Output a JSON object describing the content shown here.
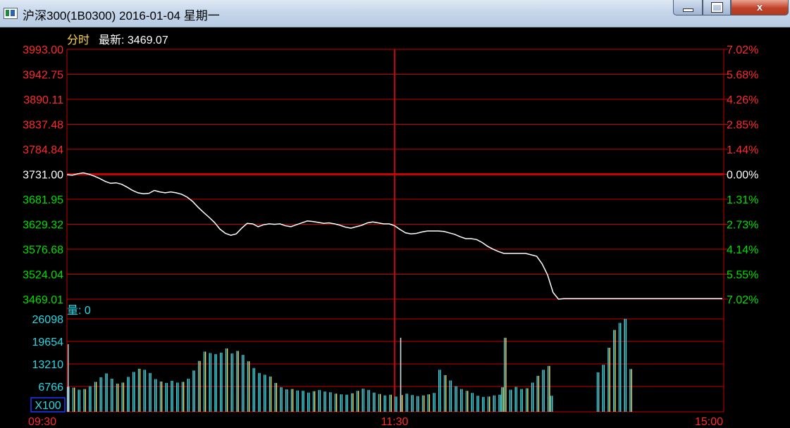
{
  "window": {
    "title": "沪深300(1B0300) 2016-01-04 星期一",
    "minimize_label": "",
    "maximize_label": "",
    "close_label": "x"
  },
  "header": {
    "mode_label": "分时",
    "latest_label": "最新: 3469.07",
    "volume_label": "量: 0"
  },
  "price_axis": {
    "left_ticks": [
      "3993.00",
      "3942.75",
      "3890.11",
      "3837.48",
      "3784.84",
      "3731.00",
      "3681.95",
      "3629.32",
      "3576.68",
      "3524.04",
      "3469.01"
    ],
    "right_ticks": [
      "7.02%",
      "5.68%",
      "4.26%",
      "2.85%",
      "1.44%",
      "0.00%",
      "1.31%",
      "2.73%",
      "4.14%",
      "5.55%",
      "7.02%"
    ],
    "up_color": "#ff2a2a",
    "flat_color": "#ffffff",
    "down_color": "#00e000"
  },
  "volume_axis": {
    "ticks": [
      "26098",
      "19654",
      "13210",
      "6766"
    ],
    "unit_label": "X100"
  },
  "time_axis": {
    "labels": [
      "09:30",
      "11:30",
      "15:00"
    ]
  },
  "chart_data": {
    "type": "line",
    "x_unit": "minutes since 09:30 session open",
    "reference_price": 3731.0,
    "ylim": [
      3469.01,
      3993.0
    ],
    "price": [
      [
        0,
        3730
      ],
      [
        2,
        3729
      ],
      [
        4,
        3732
      ],
      [
        6,
        3734
      ],
      [
        8,
        3731
      ],
      [
        10,
        3727
      ],
      [
        12,
        3722
      ],
      [
        14,
        3716
      ],
      [
        16,
        3712
      ],
      [
        18,
        3713
      ],
      [
        20,
        3710
      ],
      [
        22,
        3704
      ],
      [
        24,
        3697
      ],
      [
        26,
        3692
      ],
      [
        28,
        3690
      ],
      [
        30,
        3691
      ],
      [
        32,
        3697
      ],
      [
        34,
        3694
      ],
      [
        36,
        3692
      ],
      [
        38,
        3694
      ],
      [
        40,
        3692
      ],
      [
        42,
        3689
      ],
      [
        44,
        3683
      ],
      [
        46,
        3674
      ],
      [
        48,
        3662
      ],
      [
        50,
        3651
      ],
      [
        52,
        3641
      ],
      [
        54,
        3630
      ],
      [
        56,
        3616
      ],
      [
        58,
        3607
      ],
      [
        60,
        3603
      ],
      [
        62,
        3606
      ],
      [
        64,
        3618
      ],
      [
        66,
        3628
      ],
      [
        68,
        3627
      ],
      [
        70,
        3621
      ],
      [
        72,
        3625
      ],
      [
        74,
        3627
      ],
      [
        76,
        3626
      ],
      [
        78,
        3627
      ],
      [
        80,
        3623
      ],
      [
        82,
        3621
      ],
      [
        84,
        3625
      ],
      [
        86,
        3629
      ],
      [
        88,
        3633
      ],
      [
        90,
        3632
      ],
      [
        92,
        3630
      ],
      [
        94,
        3628
      ],
      [
        96,
        3629
      ],
      [
        98,
        3627
      ],
      [
        100,
        3624
      ],
      [
        102,
        3620
      ],
      [
        104,
        3618
      ],
      [
        106,
        3621
      ],
      [
        108,
        3624
      ],
      [
        110,
        3629
      ],
      [
        112,
        3631
      ],
      [
        114,
        3629
      ],
      [
        116,
        3627
      ],
      [
        118,
        3627
      ],
      [
        120,
        3623
      ],
      [
        122,
        3615
      ],
      [
        124,
        3608
      ],
      [
        126,
        3606
      ],
      [
        128,
        3607
      ],
      [
        130,
        3610
      ],
      [
        132,
        3612
      ],
      [
        134,
        3612
      ],
      [
        136,
        3612
      ],
      [
        138,
        3611
      ],
      [
        140,
        3608
      ],
      [
        142,
        3605
      ],
      [
        144,
        3600
      ],
      [
        146,
        3596
      ],
      [
        148,
        3596
      ],
      [
        150,
        3594
      ],
      [
        152,
        3588
      ],
      [
        154,
        3580
      ],
      [
        156,
        3574
      ],
      [
        158,
        3569
      ],
      [
        160,
        3565
      ],
      [
        162,
        3565
      ],
      [
        164,
        3565
      ],
      [
        166,
        3565
      ],
      [
        168,
        3565
      ],
      [
        170,
        3562
      ],
      [
        172,
        3559
      ],
      [
        174,
        3543
      ],
      [
        176,
        3520
      ],
      [
        178,
        3483
      ],
      [
        180,
        3469
      ],
      [
        182,
        3470
      ],
      [
        184,
        3470
      ],
      [
        186,
        3470
      ],
      [
        188,
        3470
      ],
      [
        190,
        3470
      ],
      [
        200,
        3470
      ],
      [
        210,
        3470
      ],
      [
        220,
        3470
      ],
      [
        230,
        3470
      ],
      [
        240,
        3470
      ]
    ],
    "volume_ylim": [
      0,
      26098
    ],
    "volume": [
      [
        0,
        7000
      ],
      [
        2,
        6800
      ],
      [
        4,
        6200
      ],
      [
        6,
        6400
      ],
      [
        8,
        7200
      ],
      [
        10,
        8400
      ],
      [
        12,
        9700
      ],
      [
        14,
        10800
      ],
      [
        16,
        9300
      ],
      [
        18,
        7900
      ],
      [
        20,
        8200
      ],
      [
        22,
        9800
      ],
      [
        24,
        11200
      ],
      [
        26,
        12100
      ],
      [
        28,
        11800
      ],
      [
        30,
        10900
      ],
      [
        32,
        9200
      ],
      [
        34,
        8500
      ],
      [
        36,
        8100
      ],
      [
        38,
        8700
      ],
      [
        40,
        8200
      ],
      [
        42,
        8400
      ],
      [
        44,
        9300
      ],
      [
        46,
        11600
      ],
      [
        48,
        14300
      ],
      [
        50,
        16900
      ],
      [
        52,
        16500
      ],
      [
        54,
        16200
      ],
      [
        56,
        16600
      ],
      [
        58,
        17800
      ],
      [
        60,
        16400
      ],
      [
        62,
        17100
      ],
      [
        64,
        16000
      ],
      [
        66,
        14200
      ],
      [
        68,
        12300
      ],
      [
        70,
        10900
      ],
      [
        72,
        10400
      ],
      [
        74,
        9900
      ],
      [
        76,
        8100
      ],
      [
        78,
        6900
      ],
      [
        80,
        6300
      ],
      [
        82,
        6400
      ],
      [
        84,
        6000
      ],
      [
        86,
        5900
      ],
      [
        88,
        5400
      ],
      [
        90,
        5800
      ],
      [
        92,
        6100
      ],
      [
        94,
        5700
      ],
      [
        96,
        5500
      ],
      [
        98,
        5100
      ],
      [
        100,
        4900
      ],
      [
        102,
        4800
      ],
      [
        104,
        5200
      ],
      [
        106,
        5900
      ],
      [
        108,
        6500
      ],
      [
        110,
        6100
      ],
      [
        112,
        5400
      ],
      [
        114,
        5000
      ],
      [
        116,
        4600
      ],
      [
        118,
        4800
      ],
      [
        120,
        4300
      ],
      [
        122,
        4700
      ],
      [
        124,
        5100
      ],
      [
        126,
        4700
      ],
      [
        128,
        4400
      ],
      [
        130,
        4600
      ],
      [
        132,
        4900
      ],
      [
        134,
        5300
      ],
      [
        136,
        11800
      ],
      [
        138,
        10300
      ],
      [
        140,
        8800
      ],
      [
        142,
        7200
      ],
      [
        144,
        6400
      ],
      [
        146,
        5900
      ],
      [
        148,
        5300
      ],
      [
        150,
        4500
      ],
      [
        152,
        4200
      ],
      [
        154,
        4300
      ],
      [
        156,
        4600
      ],
      [
        158,
        4800
      ],
      [
        159,
        6900
      ],
      [
        160,
        20800
      ],
      [
        162,
        6200
      ],
      [
        164,
        7000
      ],
      [
        166,
        6400
      ],
      [
        168,
        6600
      ],
      [
        170,
        8200
      ],
      [
        172,
        10100
      ],
      [
        174,
        11800
      ],
      [
        176,
        12900
      ],
      [
        177,
        4500
      ],
      [
        194,
        11100
      ],
      [
        196,
        13200
      ],
      [
        198,
        18000
      ],
      [
        200,
        23000
      ],
      [
        202,
        25000
      ],
      [
        204,
        26098
      ],
      [
        206,
        12000
      ]
    ]
  }
}
